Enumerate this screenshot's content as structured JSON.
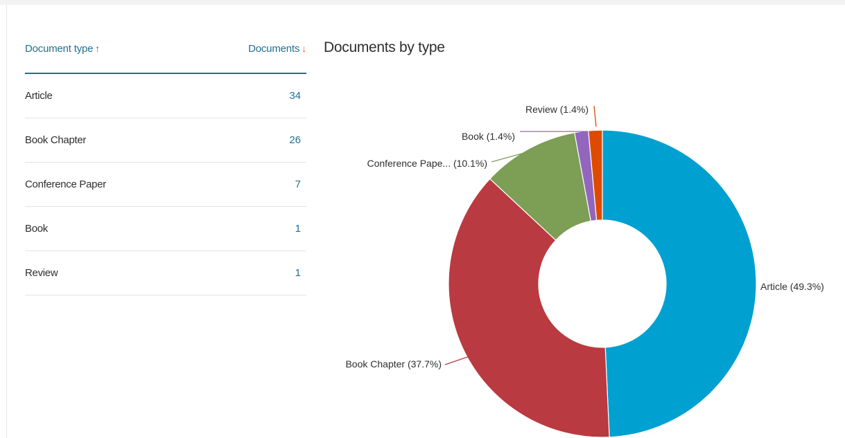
{
  "table": {
    "header": {
      "type_label": "Document type",
      "count_label": "Documents"
    },
    "rows": [
      {
        "type": "Article",
        "count": "34"
      },
      {
        "type": "Book Chapter",
        "count": "26"
      },
      {
        "type": "Conference Paper",
        "count": "7"
      },
      {
        "type": "Book",
        "count": "1"
      },
      {
        "type": "Review",
        "count": "1"
      }
    ]
  },
  "chart_data": {
    "type": "pie",
    "title": "Documents by type",
    "donut": true,
    "slices": [
      {
        "label": "Article (49.3%)",
        "value": 34,
        "percent": 49.3,
        "color": "#00a0d1"
      },
      {
        "label": "Book Chapter (37.7%)",
        "value": 26,
        "percent": 37.7,
        "color": "#b93a40"
      },
      {
        "label": "Conference Pape... (10.1%)",
        "value": 7,
        "percent": 10.1,
        "color": "#7c9e55"
      },
      {
        "label": "Book (1.4%)",
        "value": 1,
        "percent": 1.4,
        "color": "#9366bd"
      },
      {
        "label": "Review (1.4%)",
        "value": 1,
        "percent": 1.4,
        "color": "#de4b00"
      }
    ]
  }
}
